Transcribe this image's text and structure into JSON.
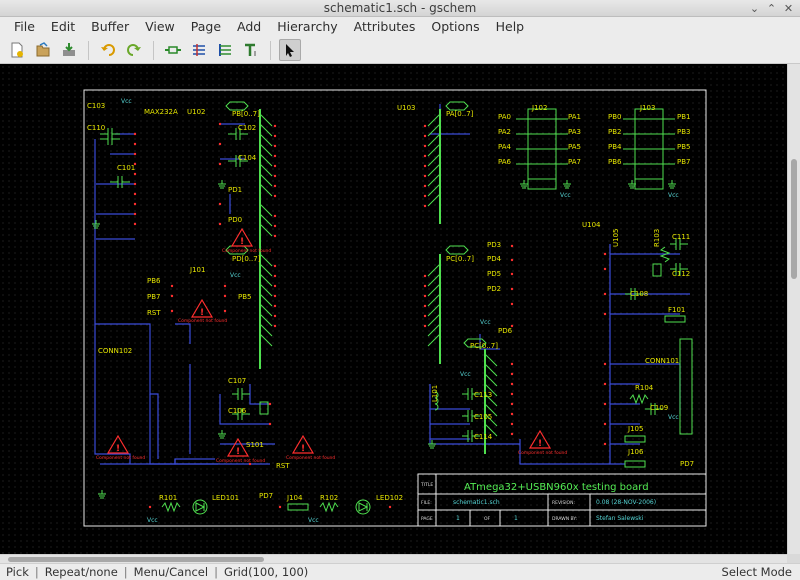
{
  "window": {
    "title": "schematic1.sch - gschem",
    "minimize_glyph": "⌄",
    "maximize_glyph": "⌃",
    "close_glyph": "✕"
  },
  "menu": [
    "File",
    "Edit",
    "Buffer",
    "View",
    "Page",
    "Add",
    "Hierarchy",
    "Attributes",
    "Options",
    "Help"
  ],
  "toolbar_icons": [
    "new-file-icon",
    "open-file-icon",
    "save-file-icon",
    "undo-icon",
    "redo-icon",
    "add-component-icon",
    "add-net-icon",
    "add-bus-icon",
    "add-text-icon",
    "select-pointer-icon"
  ],
  "schematic": {
    "components": {
      "max": "MAX232A",
      "u102": "U102",
      "u103": "U103",
      "u104": "U104",
      "u105": "U105",
      "j101": "J101",
      "j102": "J102",
      "j103": "J103",
      "j104": "J104",
      "j105": "J105",
      "j106": "J106",
      "c101": "C101",
      "c102": "C102",
      "c103": "C103",
      "c104": "C104",
      "c105": "C105",
      "c106": "C106",
      "c107": "C107",
      "c108": "C108",
      "c109": "C109",
      "c110": "C110",
      "c111": "C111",
      "c112": "C112",
      "c113": "C113",
      "c114": "C114",
      "r101": "R101",
      "r102": "R102",
      "r103": "R103",
      "r104": "R104",
      "l101": "L101",
      "f101": "F101",
      "s101": "S101",
      "led101": "LED101",
      "led102": "LED102",
      "conn101": "CONN101",
      "conn102": "CONN102"
    },
    "bus_labels": {
      "pb_bus": "PB[0..7]",
      "pd_bus": "PD[0..7]",
      "pa_bus": "PA[0..7]",
      "pc_bus": "PC[0..7]",
      "pc_bus2": "PC[0..7]"
    },
    "pin_labels": {
      "pd0": "PD0",
      "pd1": "PD1",
      "pd2": "PD2",
      "pd3": "PD3",
      "pd4": "PD4",
      "pd5": "PD5",
      "pd6": "PD6",
      "pd7": "PD7",
      "pd7b": "PD7",
      "pb5": "PB5",
      "pb6": "PB6",
      "pb7": "PB7",
      "rst": "RST",
      "rst2": "RST",
      "j102_left": [
        "PA0",
        "PA2",
        "PA4",
        "PA6"
      ],
      "j102_right": [
        "PA1",
        "PA3",
        "PA5",
        "PA7"
      ],
      "j103_left": [
        "PB0",
        "PB2",
        "PB4",
        "PB6"
      ],
      "j103_right": [
        "PB1",
        "PB3",
        "PB5",
        "PB7"
      ]
    },
    "power_label": "Vcc",
    "warning_text": "Component not found",
    "title_block": {
      "title_label": "TITLE",
      "title": "ATmega32+USBN960x testing board",
      "file_label": "FILE:",
      "file": "schematic1.sch",
      "page_label": "PAGE",
      "page": "1",
      "of_label": "OF",
      "of": "1",
      "revision_label": "REVISION:",
      "revision": "0.08 (28-NOV-2006)",
      "drawn_label": "DRAWN BY:",
      "drawn_by": "Stefan Salewski"
    }
  },
  "status": {
    "left_button": "Pick",
    "middle_button": "Repeat/none",
    "right_button": "Menu/Cancel",
    "grid": "Grid(100, 100)",
    "mode": "Select Mode"
  }
}
